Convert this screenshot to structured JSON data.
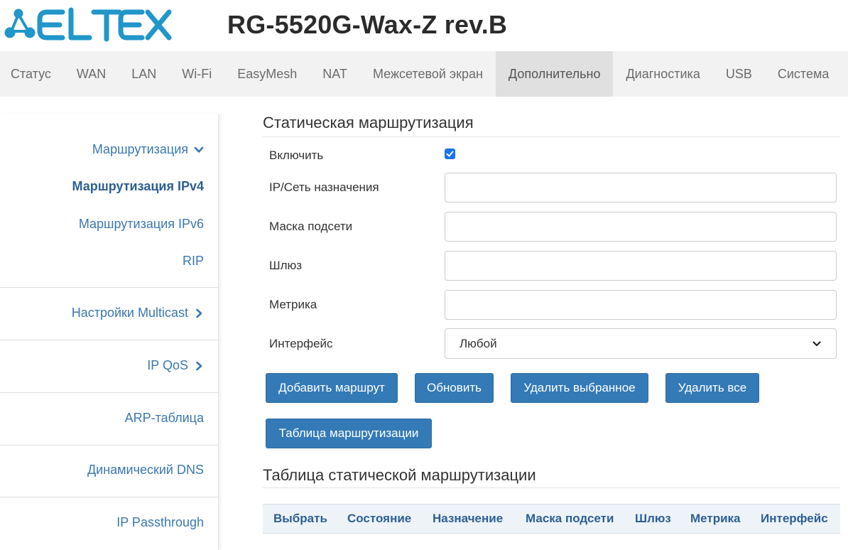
{
  "header": {
    "logo_text": "ELTEX",
    "model": "RG-5520G-Wax-Z rev.B"
  },
  "topnav": {
    "tabs": [
      {
        "label": "Статус"
      },
      {
        "label": "WAN"
      },
      {
        "label": "LAN"
      },
      {
        "label": "Wi-Fi"
      },
      {
        "label": "EasyMesh"
      },
      {
        "label": "NAT"
      },
      {
        "label": "Межсетевой экран"
      },
      {
        "label": "Дополнительно",
        "active": true
      },
      {
        "label": "Диагностика"
      },
      {
        "label": "USB"
      },
      {
        "label": "Система"
      }
    ]
  },
  "sidebar": {
    "routing": "Маршрутизация",
    "routing_ipv4": "Маршрутизация IPv4",
    "routing_ipv6": "Маршрутизация IPv6",
    "rip": "RIP",
    "multicast": "Настройки Multicast",
    "ip_qos": "IP QoS",
    "arp": "ARP-таблица",
    "ddns": "Динамический DNS",
    "ip_passthrough": "IP Passthrough"
  },
  "main": {
    "title": "Статическая маршрутизация",
    "enable_label": "Включить",
    "enable_checked": true,
    "dest_label": "IP/Сеть назначения",
    "dest_value": "",
    "mask_label": "Маска подсети",
    "mask_value": "",
    "gateway_label": "Шлюз",
    "gateway_value": "",
    "metric_label": "Метрика",
    "metric_value": "",
    "interface_label": "Интерфейс",
    "interface_value": "Любой",
    "buttons": {
      "add": "Добавить маршрут",
      "refresh": "Обновить",
      "delete_selected": "Удалить выбранное",
      "delete_all": "Удалить все",
      "routing_table": "Таблица маршрутизации"
    },
    "table_title": "Таблица статической маршрутизации",
    "table_headers": {
      "select": "Выбрать",
      "state": "Состояние",
      "destination": "Назначение",
      "mask": "Маска подсети",
      "gateway": "Шлюз",
      "metric": "Метрика",
      "interface": "Интерфейс"
    }
  },
  "colors": {
    "accent": "#337ab7",
    "link": "#3a78b0",
    "logo": "#2196c9",
    "nav_bg": "#f2f2f2",
    "nav_active_bg": "#e0e0e0"
  }
}
